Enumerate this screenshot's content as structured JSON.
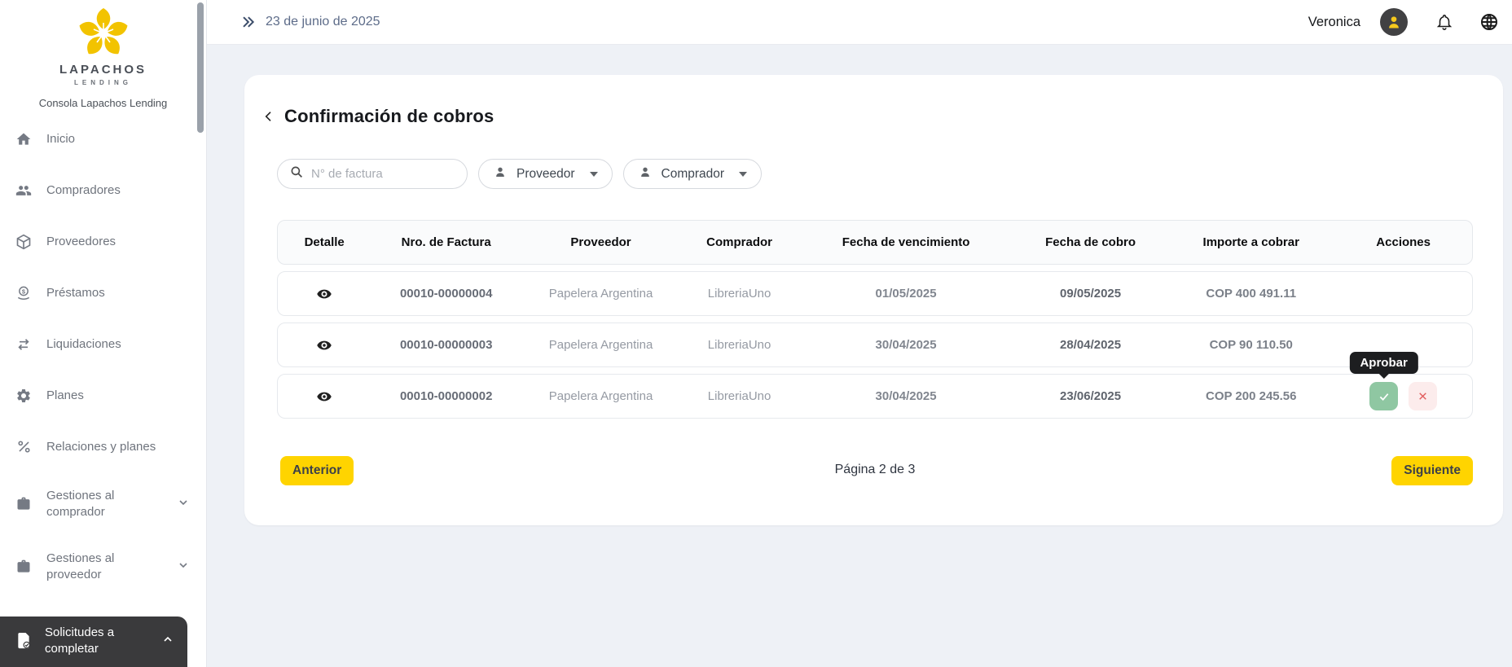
{
  "sidebar": {
    "logo": {
      "name": "LAPACHOS",
      "tagline": "LENDING"
    },
    "console_label": "Consola Lapachos Lending",
    "items": [
      {
        "label": "Inicio",
        "icon": "home-icon"
      },
      {
        "label": "Compradores",
        "icon": "people-icon"
      },
      {
        "label": "Proveedores",
        "icon": "cube-icon"
      },
      {
        "label": "Préstamos",
        "icon": "loan-coin-icon"
      },
      {
        "label": "Liquidaciones",
        "icon": "swap-arrows-icon"
      },
      {
        "label": "Planes",
        "icon": "gear-icon"
      },
      {
        "label": "Relaciones y planes",
        "icon": "percent-icon"
      },
      {
        "label": "Gestiones al comprador",
        "icon": "briefcase-icon"
      },
      {
        "label": "Gestiones al proveedor",
        "icon": "briefcase-icon"
      }
    ],
    "active_item": {
      "label": "Solicitudes a completar",
      "icon": "document-check-icon"
    }
  },
  "header": {
    "date": "23 de junio de 2025",
    "user_name": "Veronica"
  },
  "page": {
    "title": "Confirmación de cobros",
    "filters": {
      "search_placeholder": "N° de factura",
      "proveedor": "Proveedor",
      "comprador": "Comprador"
    },
    "table": {
      "columns": [
        "Detalle",
        "Nro. de Factura",
        "Proveedor",
        "Comprador",
        "Fecha de vencimiento",
        "Fecha de cobro",
        "Importe a cobrar",
        "Acciones"
      ],
      "rows": [
        {
          "invoice": "00010-00000004",
          "proveedor": "Papelera Argentina",
          "comprador": "LibreriaUno",
          "fecha_vencimiento": "01/05/2025",
          "fecha_cobro": "09/05/2025",
          "importe": "COP 400 491.11"
        },
        {
          "invoice": "00010-00000003",
          "proveedor": "Papelera Argentina",
          "comprador": "LibreriaUno",
          "fecha_vencimiento": "30/04/2025",
          "fecha_cobro": "28/04/2025",
          "importe": "COP 90 110.50"
        },
        {
          "invoice": "00010-00000002",
          "proveedor": "Papelera Argentina",
          "comprador": "LibreriaUno",
          "fecha_vencimiento": "30/04/2025",
          "fecha_cobro": "23/06/2025",
          "importe": "COP 200 245.56"
        }
      ],
      "tooltip": "Aprobar"
    },
    "pagination": {
      "previous_label": "Anterior",
      "status": "Página 2 de 3",
      "next_label": "Siguiente"
    }
  },
  "colors": {
    "accent_yellow": "#FFD400",
    "logo_gold": "#F2C300",
    "approve_green": "#8FC7A2",
    "reject_red": "#E25C5C",
    "reject_bg": "#FCECEC",
    "active_item_bg": "#3A3A3C",
    "header_date_text": "#5D6C89",
    "page_background": "#EEF1F6"
  }
}
